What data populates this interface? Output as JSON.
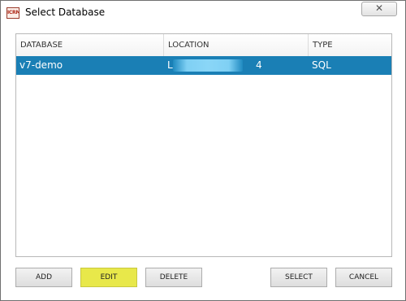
{
  "window": {
    "title": "Select Database",
    "app_icon_text": "ICRM",
    "close_glyph": "✕"
  },
  "table": {
    "columns": [
      "DATABASE",
      "LOCATION",
      "TYPE"
    ],
    "rows": [
      {
        "database": "v7-demo",
        "location_prefix": "L",
        "location_suffix": "4",
        "type": "SQL",
        "selected": true
      }
    ]
  },
  "buttons": {
    "add": "ADD",
    "edit": "EDIT",
    "delete": "DELETE",
    "select": "SELECT",
    "cancel": "CANCEL"
  },
  "colors": {
    "selection": "#1a7fb5",
    "edit_highlight": "#e8e84a"
  },
  "icons": {
    "app": "app-icon",
    "close": "close-icon"
  }
}
